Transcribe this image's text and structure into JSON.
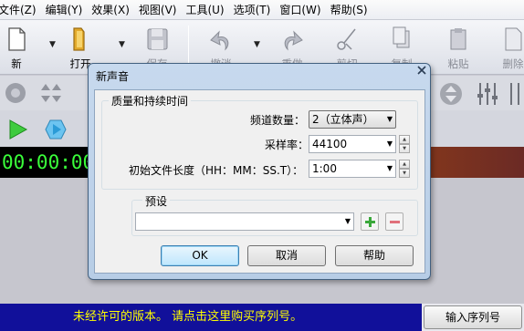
{
  "menubar": {
    "items": [
      "文件(Z)",
      "编辑(Y)",
      "效果(X)",
      "视图(V)",
      "工具(U)",
      "选项(T)",
      "窗口(W)",
      "帮助(S)"
    ]
  },
  "toolbar": {
    "new_label": "新",
    "open_label": "打开",
    "save_label": "保存",
    "undo_label": "撤消",
    "redo_label": "重做",
    "cut_label": "剪切",
    "copy_label": "复制",
    "paste_label": "粘贴",
    "delete_label": "删除"
  },
  "time_display": "00:00:00",
  "status": {
    "message": "未经许可的版本。 请点击这里购买序列号。",
    "serial_button": "输入序列号"
  },
  "dialog": {
    "title": "新声音",
    "quality_group": "质量和持续时间",
    "channels_label": "频道数量：",
    "channels_value": "2（立体声）",
    "sample_rate_label": "采样率：",
    "sample_rate_value": "44100",
    "length_label": "初始文件长度（HH：MM：SS.T）：",
    "length_value": "1:00",
    "preset_group": "预设",
    "preset_value": "",
    "ok_label": "OK",
    "cancel_label": "取消",
    "help_label": "帮助"
  },
  "colors": {
    "status_bg": "#11109a",
    "status_text": "#ffff00",
    "time_text": "#3aff3a",
    "add_green": "#3aa83a",
    "remove_red": "#e0707a"
  }
}
